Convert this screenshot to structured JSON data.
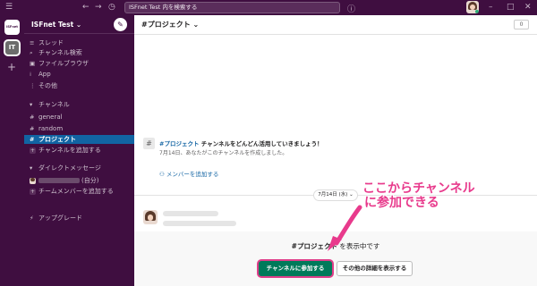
{
  "topbar": {
    "search_placeholder": "ISFnet Test 内を検索する"
  },
  "rail": {
    "workspace_initials": "IT",
    "logo_text": "ISFnet test"
  },
  "sidebar": {
    "workspace_name": "ISFnet Test",
    "nav": [
      {
        "icon": "threads-icon",
        "glyph": "≡",
        "label": "スレッド"
      },
      {
        "icon": "channel-search-icon",
        "glyph": "⌕",
        "label": "チャンネル検索"
      },
      {
        "icon": "file-browser-icon",
        "glyph": "▣",
        "label": "ファイルブラウザ"
      },
      {
        "icon": "apps-icon",
        "glyph": "⁞",
        "label": "App"
      },
      {
        "icon": "more-icon",
        "glyph": "⋮",
        "label": "その他"
      }
    ],
    "channels_header": "チャンネル",
    "channels": [
      {
        "label": "general"
      },
      {
        "label": "random"
      },
      {
        "label": "プロジェクト"
      }
    ],
    "add_channel": "チャンネルを追加する",
    "dm_header": "ダイレクトメッセージ",
    "dm_self_suffix": "(自分)",
    "add_member": "チームメンバーを追加する",
    "upgrade": "アップグレード"
  },
  "channel": {
    "title": "#プロジェクト ⌄",
    "member_count": "0",
    "intro_link": "#プロジェクト",
    "intro_text": "チャンネルをどんどん活用していきましょう！",
    "intro_sub": "7月14日、あなたがこのチャンネルを作成しました。",
    "add_member_link": "メンバーを追加する",
    "date_pill": "7月14日 (水) ⌄"
  },
  "join": {
    "preview_channel": "#プロジェクト",
    "preview_suffix": "を表示中です",
    "join_button": "チャンネルに参加する",
    "details_button": "その他の詳細を表示する"
  },
  "annotation": {
    "line1": "ここからチャンネル",
    "line2": "に参加できる",
    "color": "#e83a8c"
  },
  "colors": {
    "sidebar_bg": "#3f0e40",
    "active_bg": "#1164a3",
    "join_green": "#007a5a"
  }
}
